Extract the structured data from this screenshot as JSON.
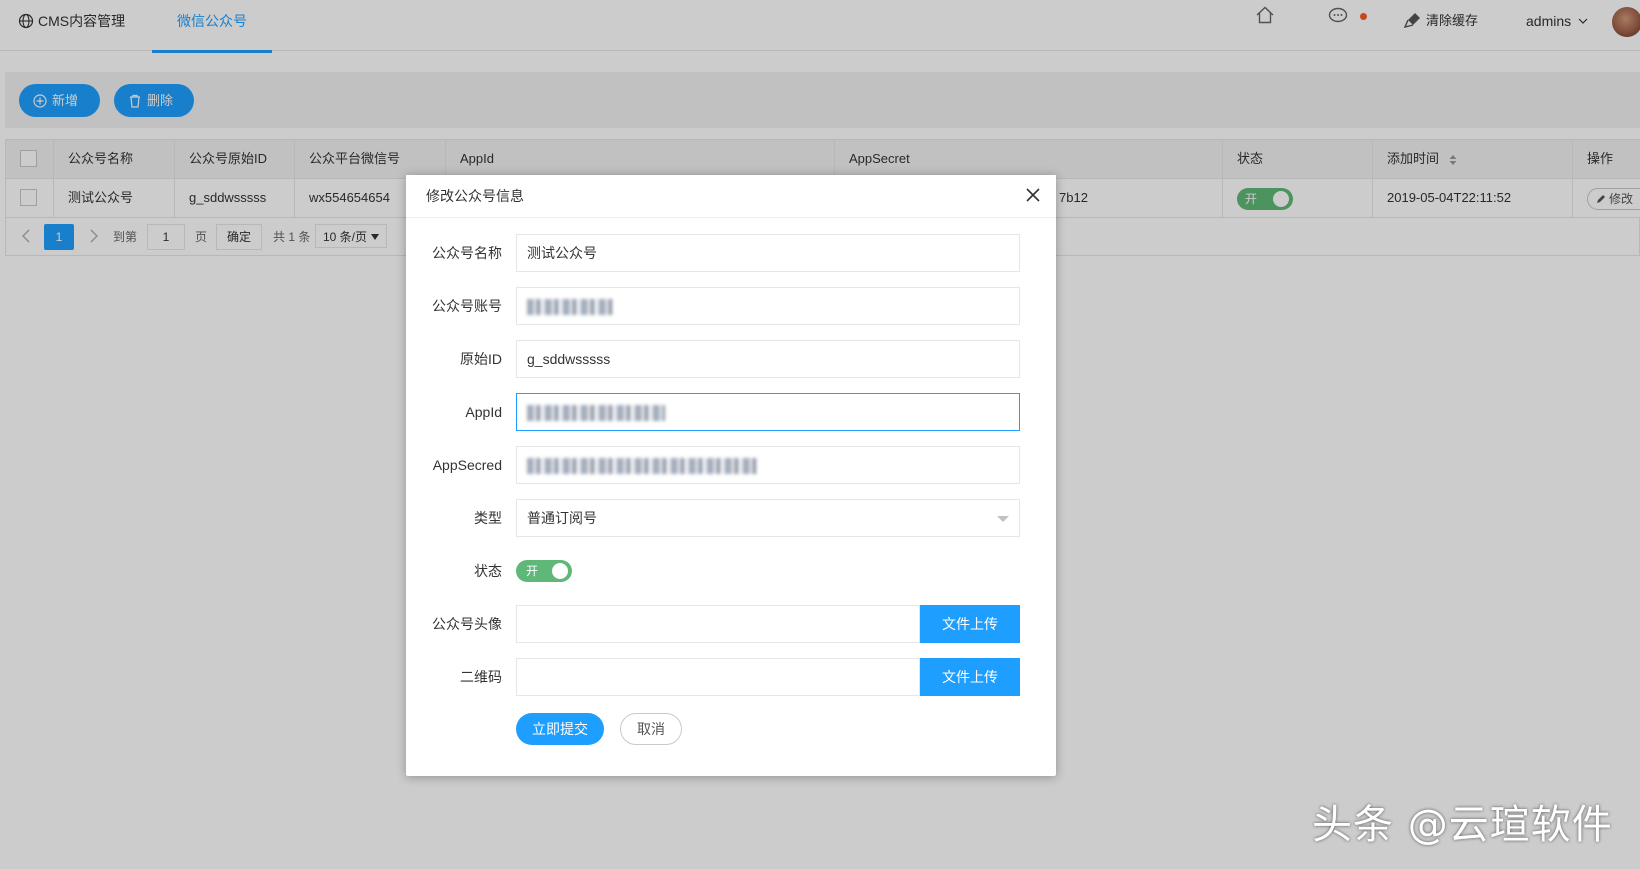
{
  "header": {
    "nav_cms": "CMS内容管理",
    "nav_wechat": "微信公众号",
    "clear_cache": "清除缓存",
    "user": "admins"
  },
  "toolbar": {
    "add_label": "新增",
    "delete_label": "删除"
  },
  "table": {
    "columns": [
      "公众号名称",
      "公众号原始ID",
      "公众平台微信号",
      "AppId",
      "AppSecret",
      "状态",
      "添加时间",
      "操作"
    ],
    "rows": [
      {
        "name": "测试公众号",
        "original_id": "g_sddwsssss",
        "platform_wx": "wx554654654",
        "appsecret_tail": "7b12",
        "status": "开",
        "added_time": "2019-05-04T22:11:52",
        "action": "修改"
      }
    ]
  },
  "pager": {
    "current": "1",
    "goto_label": "到第",
    "page_input": "1",
    "page_unit": "页",
    "confirm": "确定",
    "total": "共 1 条",
    "page_size": "10 条/页"
  },
  "dialog": {
    "title": "修改公众号信息",
    "fields": {
      "name_label": "公众号名称",
      "name_value": "测试公众号",
      "account_label": "公众号账号",
      "origid_label": "原始ID",
      "origid_value": "g_sddwsssss",
      "appid_label": "AppId",
      "appsecret_label": "AppSecred",
      "type_label": "类型",
      "type_value": "普通订阅号",
      "status_label": "状态",
      "status_value": "开",
      "avatar_label": "公众号头像",
      "qrcode_label": "二维码"
    },
    "upload_label": "文件上传",
    "submit_label": "立即提交",
    "cancel_label": "取消"
  },
  "watermark": "头条 @云瑄软件",
  "colors": {
    "primary": "#1E9FFF",
    "switch_on": "#5FB878",
    "dot": "#FF5722"
  }
}
